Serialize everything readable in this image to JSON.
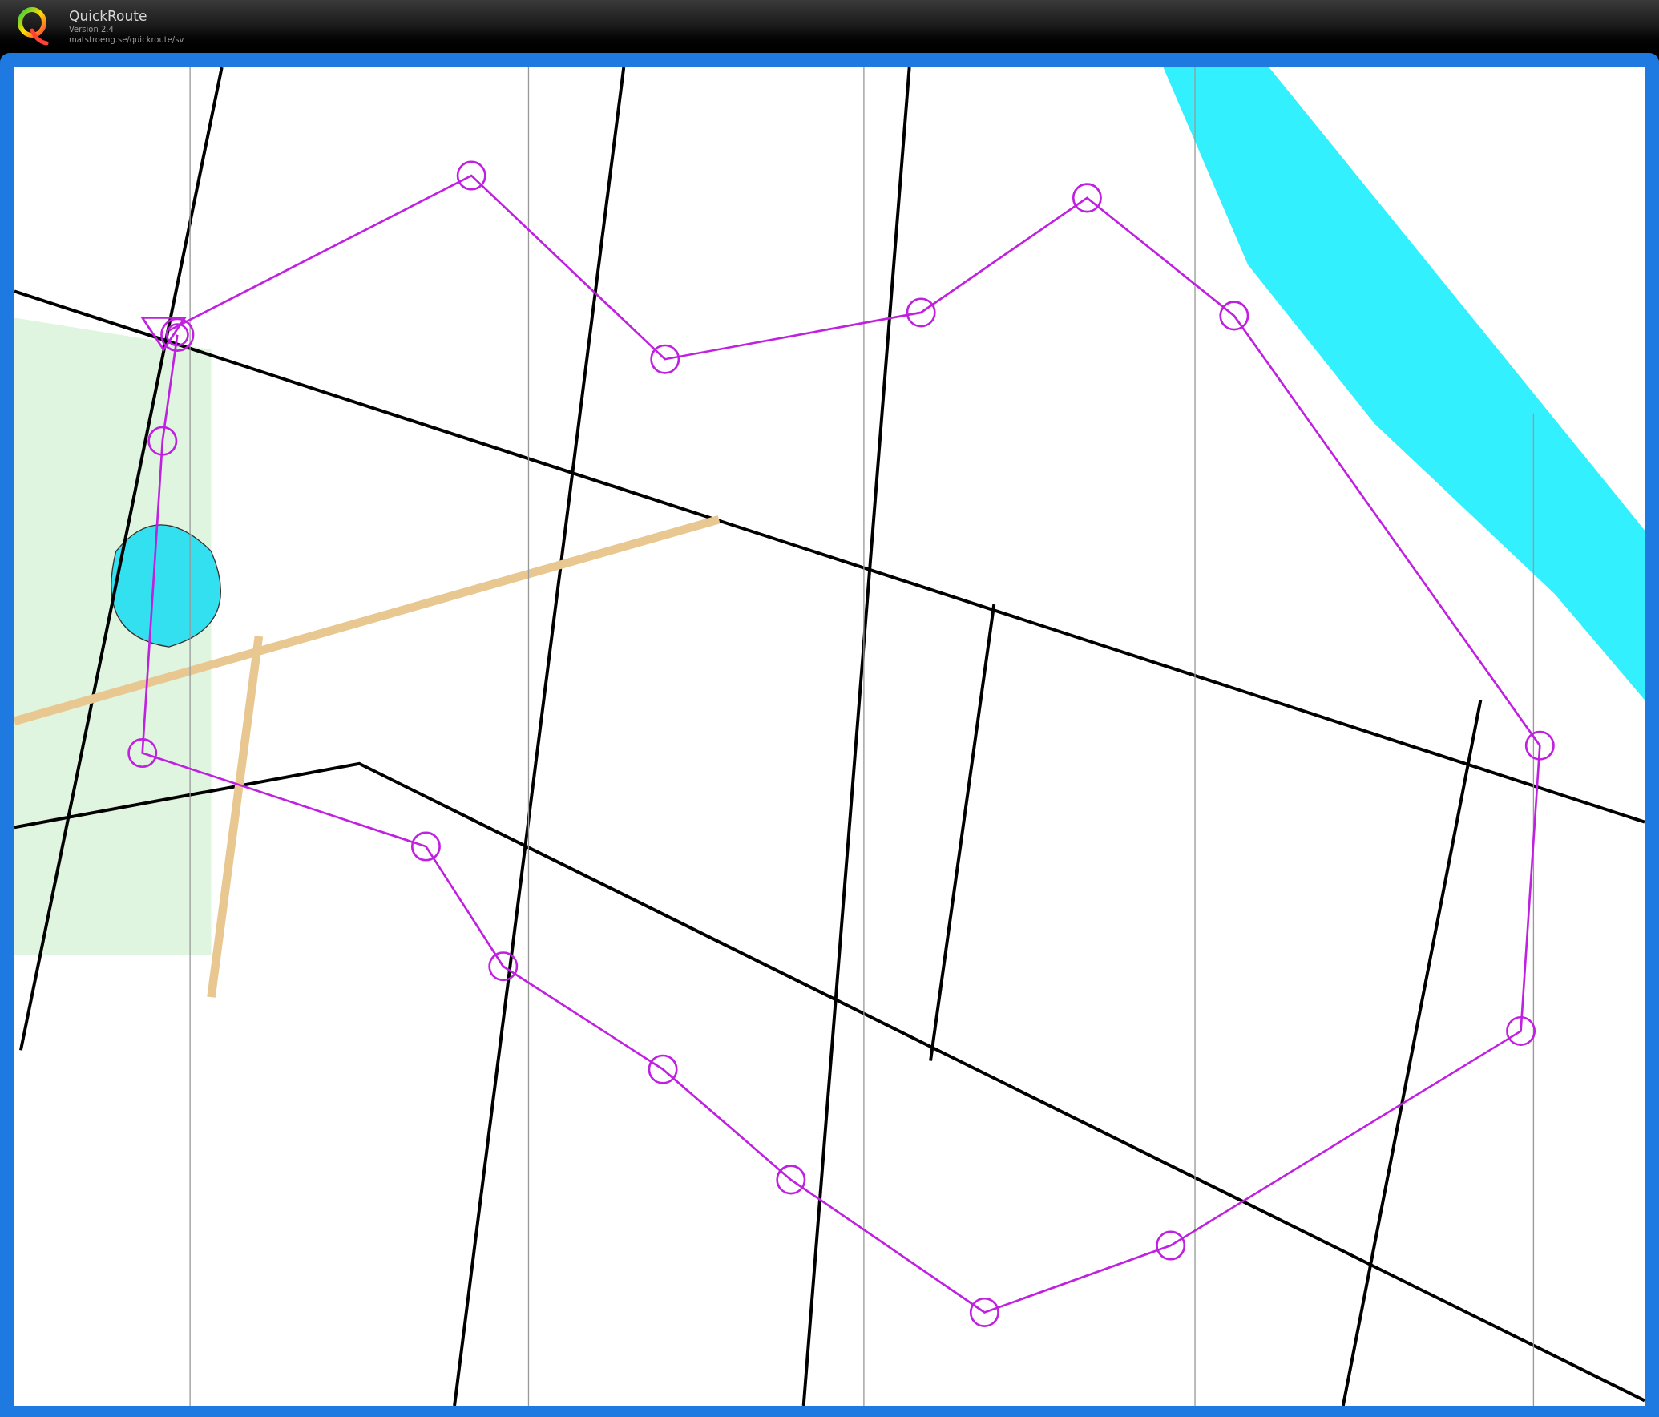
{
  "app": {
    "title": "QuickRoute",
    "version": "Version 2.4",
    "url": "matstroeng.se/quickroute/sv"
  }
}
